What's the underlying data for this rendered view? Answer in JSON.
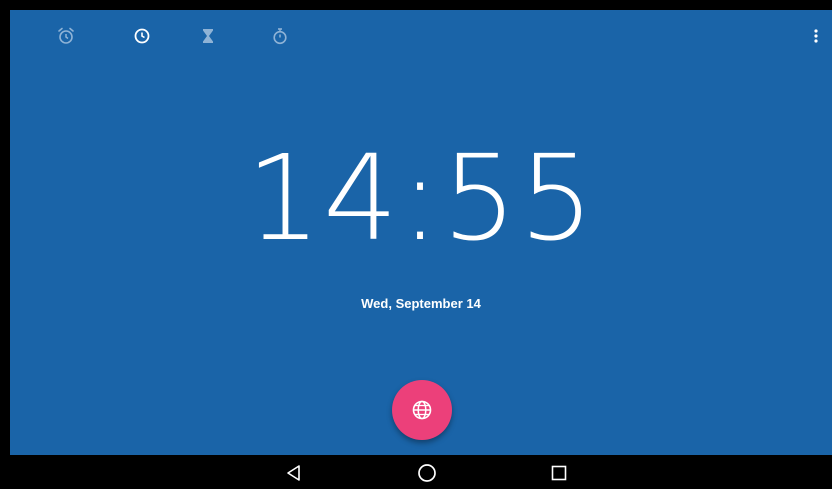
{
  "status_bar": {
    "tabs": [
      {
        "name": "alarm",
        "icon": "alarm-icon",
        "selected": false
      },
      {
        "name": "clock",
        "icon": "clock-icon",
        "selected": true
      },
      {
        "name": "timer",
        "icon": "hourglass-icon",
        "selected": false
      },
      {
        "name": "stopwatch",
        "icon": "stopwatch-icon",
        "selected": false
      }
    ],
    "overflow_icon": "more-vert-icon"
  },
  "clock": {
    "time": "14:55",
    "date": "Wed, September 14"
  },
  "fab": {
    "icon": "globe-icon",
    "color": "#ec407a"
  },
  "nav_bar": {
    "back_icon": "back-triangle-icon",
    "home_icon": "home-circle-icon",
    "recents_icon": "recents-square-icon"
  },
  "colors": {
    "background": "#1a64a8",
    "foreground": "#ffffff",
    "inactive_icon": "#8fb3d6",
    "nav_background": "#000000"
  }
}
